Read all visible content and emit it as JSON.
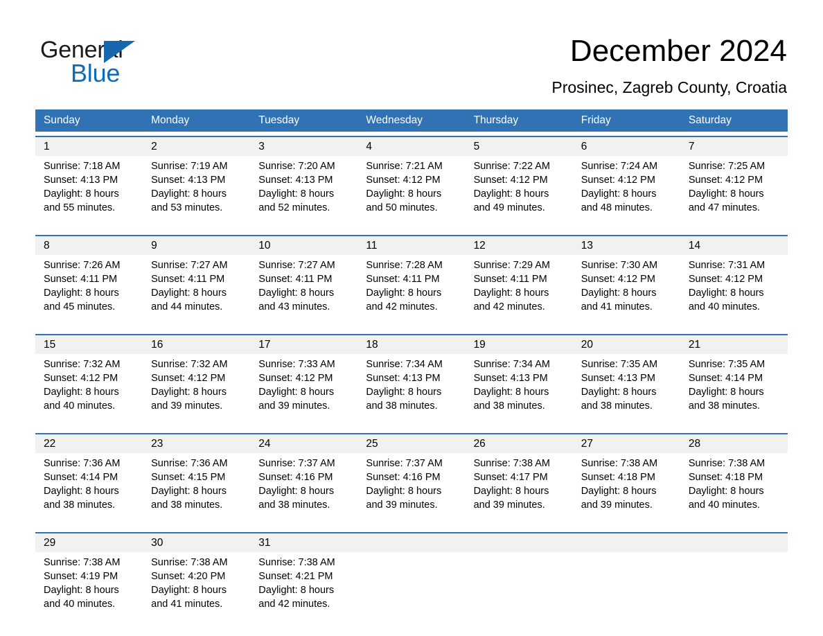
{
  "brand": {
    "name_part1": "General",
    "name_part2": "Blue",
    "logo_icon": "triangle-flag-icon",
    "accent_color": "#1767ae",
    "blue_text_color": "#0e6cb5"
  },
  "header": {
    "title": "December 2024",
    "subtitle": "Prosinec, Zagreb County, Croatia"
  },
  "theme": {
    "header_blue": "#3072b3",
    "daynum_band_gray": "#f1f1f1",
    "row_divider_blue": "#3072b3"
  },
  "weekdays": [
    "Sunday",
    "Monday",
    "Tuesday",
    "Wednesday",
    "Thursday",
    "Friday",
    "Saturday"
  ],
  "weeks": [
    {
      "days": [
        {
          "day": "1",
          "sunrise": "Sunrise: 7:18 AM",
          "sunset": "Sunset: 4:13 PM",
          "daylight1": "Daylight: 8 hours",
          "daylight2": "and 55 minutes."
        },
        {
          "day": "2",
          "sunrise": "Sunrise: 7:19 AM",
          "sunset": "Sunset: 4:13 PM",
          "daylight1": "Daylight: 8 hours",
          "daylight2": "and 53 minutes."
        },
        {
          "day": "3",
          "sunrise": "Sunrise: 7:20 AM",
          "sunset": "Sunset: 4:13 PM",
          "daylight1": "Daylight: 8 hours",
          "daylight2": "and 52 minutes."
        },
        {
          "day": "4",
          "sunrise": "Sunrise: 7:21 AM",
          "sunset": "Sunset: 4:12 PM",
          "daylight1": "Daylight: 8 hours",
          "daylight2": "and 50 minutes."
        },
        {
          "day": "5",
          "sunrise": "Sunrise: 7:22 AM",
          "sunset": "Sunset: 4:12 PM",
          "daylight1": "Daylight: 8 hours",
          "daylight2": "and 49 minutes."
        },
        {
          "day": "6",
          "sunrise": "Sunrise: 7:24 AM",
          "sunset": "Sunset: 4:12 PM",
          "daylight1": "Daylight: 8 hours",
          "daylight2": "and 48 minutes."
        },
        {
          "day": "7",
          "sunrise": "Sunrise: 7:25 AM",
          "sunset": "Sunset: 4:12 PM",
          "daylight1": "Daylight: 8 hours",
          "daylight2": "and 47 minutes."
        }
      ]
    },
    {
      "days": [
        {
          "day": "8",
          "sunrise": "Sunrise: 7:26 AM",
          "sunset": "Sunset: 4:11 PM",
          "daylight1": "Daylight: 8 hours",
          "daylight2": "and 45 minutes."
        },
        {
          "day": "9",
          "sunrise": "Sunrise: 7:27 AM",
          "sunset": "Sunset: 4:11 PM",
          "daylight1": "Daylight: 8 hours",
          "daylight2": "and 44 minutes."
        },
        {
          "day": "10",
          "sunrise": "Sunrise: 7:27 AM",
          "sunset": "Sunset: 4:11 PM",
          "daylight1": "Daylight: 8 hours",
          "daylight2": "and 43 minutes."
        },
        {
          "day": "11",
          "sunrise": "Sunrise: 7:28 AM",
          "sunset": "Sunset: 4:11 PM",
          "daylight1": "Daylight: 8 hours",
          "daylight2": "and 42 minutes."
        },
        {
          "day": "12",
          "sunrise": "Sunrise: 7:29 AM",
          "sunset": "Sunset: 4:11 PM",
          "daylight1": "Daylight: 8 hours",
          "daylight2": "and 42 minutes."
        },
        {
          "day": "13",
          "sunrise": "Sunrise: 7:30 AM",
          "sunset": "Sunset: 4:12 PM",
          "daylight1": "Daylight: 8 hours",
          "daylight2": "and 41 minutes."
        },
        {
          "day": "14",
          "sunrise": "Sunrise: 7:31 AM",
          "sunset": "Sunset: 4:12 PM",
          "daylight1": "Daylight: 8 hours",
          "daylight2": "and 40 minutes."
        }
      ]
    },
    {
      "days": [
        {
          "day": "15",
          "sunrise": "Sunrise: 7:32 AM",
          "sunset": "Sunset: 4:12 PM",
          "daylight1": "Daylight: 8 hours",
          "daylight2": "and 40 minutes."
        },
        {
          "day": "16",
          "sunrise": "Sunrise: 7:32 AM",
          "sunset": "Sunset: 4:12 PM",
          "daylight1": "Daylight: 8 hours",
          "daylight2": "and 39 minutes."
        },
        {
          "day": "17",
          "sunrise": "Sunrise: 7:33 AM",
          "sunset": "Sunset: 4:12 PM",
          "daylight1": "Daylight: 8 hours",
          "daylight2": "and 39 minutes."
        },
        {
          "day": "18",
          "sunrise": "Sunrise: 7:34 AM",
          "sunset": "Sunset: 4:13 PM",
          "daylight1": "Daylight: 8 hours",
          "daylight2": "and 38 minutes."
        },
        {
          "day": "19",
          "sunrise": "Sunrise: 7:34 AM",
          "sunset": "Sunset: 4:13 PM",
          "daylight1": "Daylight: 8 hours",
          "daylight2": "and 38 minutes."
        },
        {
          "day": "20",
          "sunrise": "Sunrise: 7:35 AM",
          "sunset": "Sunset: 4:13 PM",
          "daylight1": "Daylight: 8 hours",
          "daylight2": "and 38 minutes."
        },
        {
          "day": "21",
          "sunrise": "Sunrise: 7:35 AM",
          "sunset": "Sunset: 4:14 PM",
          "daylight1": "Daylight: 8 hours",
          "daylight2": "and 38 minutes."
        }
      ]
    },
    {
      "days": [
        {
          "day": "22",
          "sunrise": "Sunrise: 7:36 AM",
          "sunset": "Sunset: 4:14 PM",
          "daylight1": "Daylight: 8 hours",
          "daylight2": "and 38 minutes."
        },
        {
          "day": "23",
          "sunrise": "Sunrise: 7:36 AM",
          "sunset": "Sunset: 4:15 PM",
          "daylight1": "Daylight: 8 hours",
          "daylight2": "and 38 minutes."
        },
        {
          "day": "24",
          "sunrise": "Sunrise: 7:37 AM",
          "sunset": "Sunset: 4:16 PM",
          "daylight1": "Daylight: 8 hours",
          "daylight2": "and 38 minutes."
        },
        {
          "day": "25",
          "sunrise": "Sunrise: 7:37 AM",
          "sunset": "Sunset: 4:16 PM",
          "daylight1": "Daylight: 8 hours",
          "daylight2": "and 39 minutes."
        },
        {
          "day": "26",
          "sunrise": "Sunrise: 7:38 AM",
          "sunset": "Sunset: 4:17 PM",
          "daylight1": "Daylight: 8 hours",
          "daylight2": "and 39 minutes."
        },
        {
          "day": "27",
          "sunrise": "Sunrise: 7:38 AM",
          "sunset": "Sunset: 4:18 PM",
          "daylight1": "Daylight: 8 hours",
          "daylight2": "and 39 minutes."
        },
        {
          "day": "28",
          "sunrise": "Sunrise: 7:38 AM",
          "sunset": "Sunset: 4:18 PM",
          "daylight1": "Daylight: 8 hours",
          "daylight2": "and 40 minutes."
        }
      ]
    },
    {
      "days": [
        {
          "day": "29",
          "sunrise": "Sunrise: 7:38 AM",
          "sunset": "Sunset: 4:19 PM",
          "daylight1": "Daylight: 8 hours",
          "daylight2": "and 40 minutes."
        },
        {
          "day": "30",
          "sunrise": "Sunrise: 7:38 AM",
          "sunset": "Sunset: 4:20 PM",
          "daylight1": "Daylight: 8 hours",
          "daylight2": "and 41 minutes."
        },
        {
          "day": "31",
          "sunrise": "Sunrise: 7:38 AM",
          "sunset": "Sunset: 4:21 PM",
          "daylight1": "Daylight: 8 hours",
          "daylight2": "and 42 minutes."
        },
        {
          "day": "",
          "sunrise": "",
          "sunset": "",
          "daylight1": "",
          "daylight2": "",
          "empty": true
        },
        {
          "day": "",
          "sunrise": "",
          "sunset": "",
          "daylight1": "",
          "daylight2": "",
          "empty": true
        },
        {
          "day": "",
          "sunrise": "",
          "sunset": "",
          "daylight1": "",
          "daylight2": "",
          "empty": true
        },
        {
          "day": "",
          "sunrise": "",
          "sunset": "",
          "daylight1": "",
          "daylight2": "",
          "empty": true
        }
      ]
    }
  ]
}
